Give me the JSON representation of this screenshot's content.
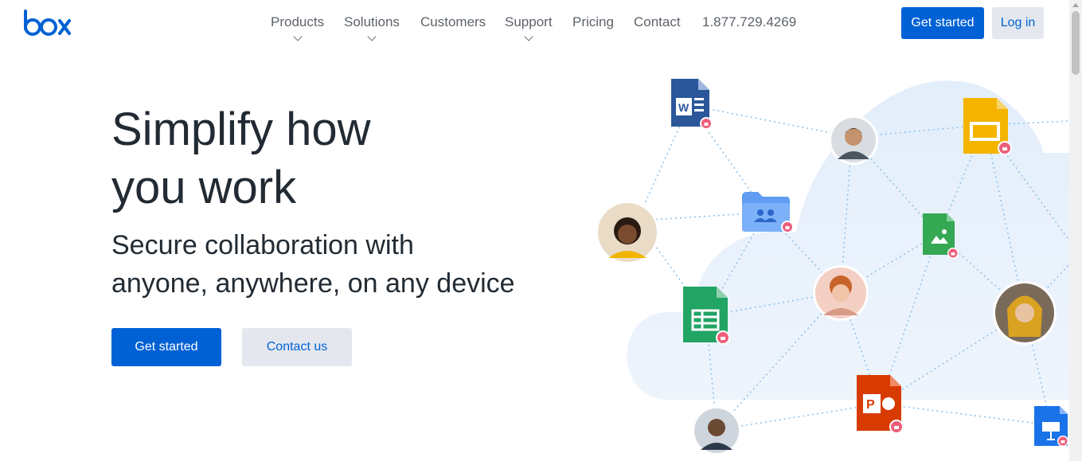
{
  "brand": {
    "logo_text": "box",
    "color": "#0061d5"
  },
  "nav": {
    "items": [
      {
        "label": "Products",
        "has_menu": true
      },
      {
        "label": "Solutions",
        "has_menu": true
      },
      {
        "label": "Customers",
        "has_menu": false
      },
      {
        "label": "Support",
        "has_menu": true
      },
      {
        "label": "Pricing",
        "has_menu": false
      },
      {
        "label": "Contact",
        "has_menu": false
      }
    ],
    "phone": "1.877.729.4269",
    "get_started_label": "Get started",
    "login_label": "Log in"
  },
  "hero": {
    "title_line1": "Simplify how",
    "title_line2": "you work",
    "subtitle_line1": "Secure collaboration with",
    "subtitle_line2": "anyone, anywhere, on any device",
    "primary_cta": "Get started",
    "secondary_cta": "Contact us"
  },
  "illustration": {
    "icons": [
      "word-doc-icon",
      "google-slides-icon",
      "shared-folder-icon",
      "image-file-icon",
      "google-sheets-icon",
      "powerpoint-icon",
      "keynote-icon"
    ],
    "avatars": 5,
    "colors": {
      "cloud": "#eaf2fc",
      "connector": "#8fc3ec",
      "lock": "#ed5e7a"
    }
  }
}
